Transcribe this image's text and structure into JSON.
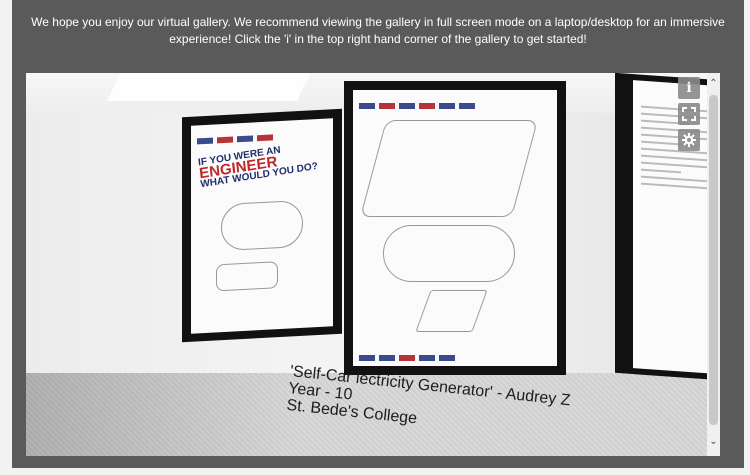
{
  "intro_text": "We hope you enjoy our virtual gallery. We recommend viewing the gallery in full screen mode on a laptop/desktop for an immersive experience! Click the 'i' in the top right hand corner of the gallery to get started!",
  "gallery": {
    "poster1": {
      "heading_line1": "IF YOU WERE AN",
      "heading_big": "ENGINEER",
      "heading_line2": "WHAT WOULD YOU DO?"
    },
    "caption": {
      "title": "'Self-Car lectricity Generator' - Audrey Z",
      "year": "Year - 10",
      "school": "St. Bede's College"
    },
    "controls": {
      "info_icon": "info-icon",
      "fullscreen_icon": "fullscreen-icon",
      "settings_icon": "gear-icon",
      "info_label": "i"
    }
  },
  "scroll": {
    "up": "⌃",
    "down": "⌄"
  }
}
